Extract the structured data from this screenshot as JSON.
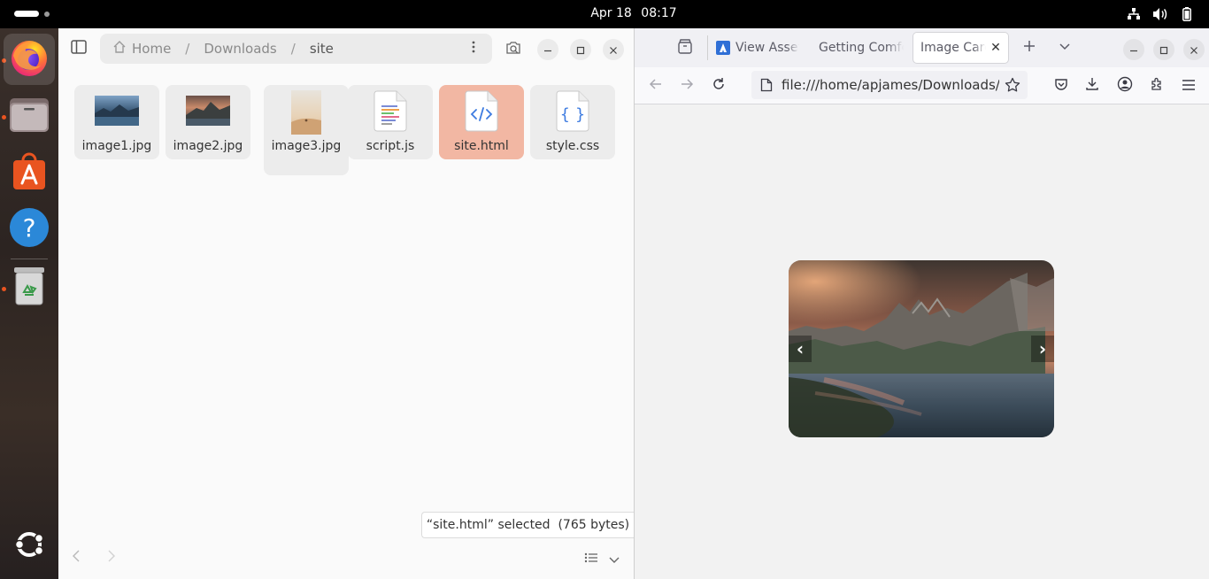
{
  "topbar": {
    "date": "Apr 18",
    "time": "08:17",
    "tray_icons": [
      "network-icon",
      "volume-icon",
      "battery-icon"
    ]
  },
  "dock": {
    "items": [
      {
        "name": "firefox",
        "icon": "firefox-icon",
        "running": true,
        "active": true
      },
      {
        "name": "files",
        "icon": "files-icon",
        "running": true
      },
      {
        "name": "app-center",
        "icon": "app-center-icon",
        "running": false
      },
      {
        "name": "help",
        "icon": "help-icon",
        "running": false
      },
      {
        "name": "trash",
        "icon": "trash-icon",
        "running": true
      },
      {
        "name": "show-apps",
        "icon": "ubuntu-icon",
        "running": false
      }
    ]
  },
  "files": {
    "breadcrumb": {
      "home": "Home",
      "downloads": "Downloads",
      "current": "site"
    },
    "items": [
      {
        "name": "image1.jpg",
        "type": "image"
      },
      {
        "name": "image2.jpg",
        "type": "image"
      },
      {
        "name": "image3.jpg",
        "type": "image"
      },
      {
        "name": "script.js",
        "type": "text"
      },
      {
        "name": "site.html",
        "type": "html",
        "selected": true
      },
      {
        "name": "style.css",
        "type": "css"
      }
    ],
    "status": "“site.html” selected  (765 bytes)",
    "accent_color": "#f2b7a3"
  },
  "firefox": {
    "tabs": [
      {
        "label": "View Assets",
        "active": false
      },
      {
        "label": "Getting Comfortable",
        "active": false
      },
      {
        "label": "Image Carousel",
        "active": true
      }
    ],
    "close_glyph": "✕",
    "url": "file:///home/apjames/Downloads/site/site.html",
    "carousel": {
      "prev": "‹",
      "next": "›"
    }
  }
}
